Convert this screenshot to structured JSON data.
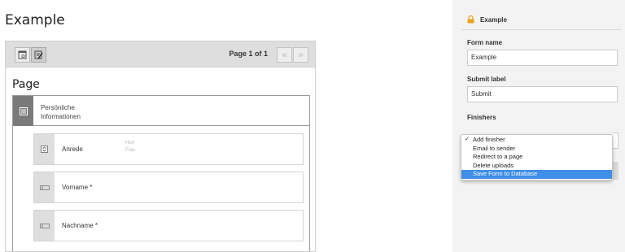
{
  "page": {
    "title": "Example"
  },
  "stage": {
    "pager": {
      "text": "Page 1 of 1",
      "prev": "«",
      "next": "»"
    },
    "section_title": "Page",
    "section": {
      "label_line1": "Persönliche",
      "label_line2": "Informationen"
    },
    "fields": [
      {
        "label": "Anrede",
        "options": [
          "Herr",
          "Frau"
        ]
      },
      {
        "label": "Vorname *"
      },
      {
        "label": "Nachname *"
      }
    ]
  },
  "inspector": {
    "title": "Example",
    "form_name_label": "Form name",
    "form_name_value": "Example",
    "submit_label_label": "Submit label",
    "submit_label_value": "Submit",
    "finishers_label": "Finishers",
    "dropdown": {
      "items": [
        "Add finisher",
        "Email to sender",
        "Redirect to a page",
        "Delete uploads",
        "Save Form to Database"
      ],
      "checked_index": 0,
      "highlighted_index": 4
    }
  },
  "colors": {
    "highlight": "#3f8ee8",
    "section_icon_bg": "#7a7a7a",
    "lock_icon": "#e8a317"
  }
}
